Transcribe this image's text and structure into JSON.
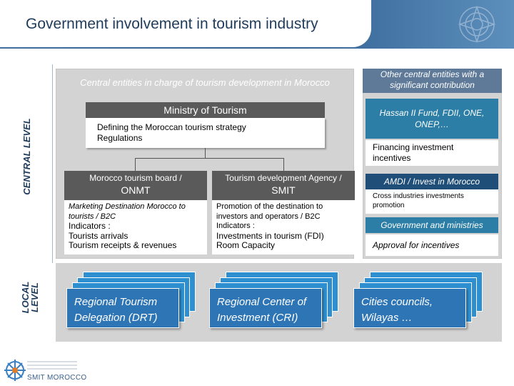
{
  "slide": {
    "title": "Government involvement in tourism industry",
    "central_level_label": "CENTRAL LEVEL",
    "local_level_label": "LOCAL LEVEL"
  },
  "left_panel": {
    "heading": "Central entities in charge of  tourism development in Morocco",
    "ministry": {
      "title": "Ministry of Tourism",
      "description": "Defining the Moroccan tourism strategy\nRegulations"
    },
    "onmt": {
      "header_line1": "Morocco tourism board /",
      "header_line2": "ONMT",
      "mission": "Marketing Destination Morocco to tourists / B2C",
      "indicators_label": "Indicators :",
      "indicators": "Tourists  arrivals\nTourism receipts & revenues"
    },
    "smit": {
      "header_line1": "Tourism development Agency /",
      "header_line2": "SMIT",
      "mission": "Promotion of the destination to investors and operators / B2C",
      "indicators_label": "Indicators :",
      "indicators": "Investments in tourism (FDI)\nRoom Capacity"
    }
  },
  "right_panel": {
    "heading": "Other central entities with a significant contribution",
    "items": [
      {
        "title": "Hassan II Fund,  FDII, ONE, ONEP,…",
        "desc": "Financing investment incentives"
      },
      {
        "title": "AMDI / Invest in Morocco",
        "desc": "Cross industries investments promotion"
      },
      {
        "title": "Government and ministries",
        "desc": "Approval for incentives"
      }
    ]
  },
  "local": {
    "items": [
      {
        "label": "Regional Tourism Delegation (DRT)"
      },
      {
        "label": "Regional Center  of Investment (CRI)"
      },
      {
        "label": "Cities councils, Wilayas …"
      }
    ]
  },
  "footer": {
    "logo_text": "SMIT MOROCCO"
  },
  "colors": {
    "header_blue": "#2f5f8f",
    "panel_grey": "#d3d3d3",
    "dark_grey": "#5a5a5a",
    "navy": "#1f4e79",
    "teal": "#2c7ea6",
    "local_blue": "#2e75b6"
  }
}
